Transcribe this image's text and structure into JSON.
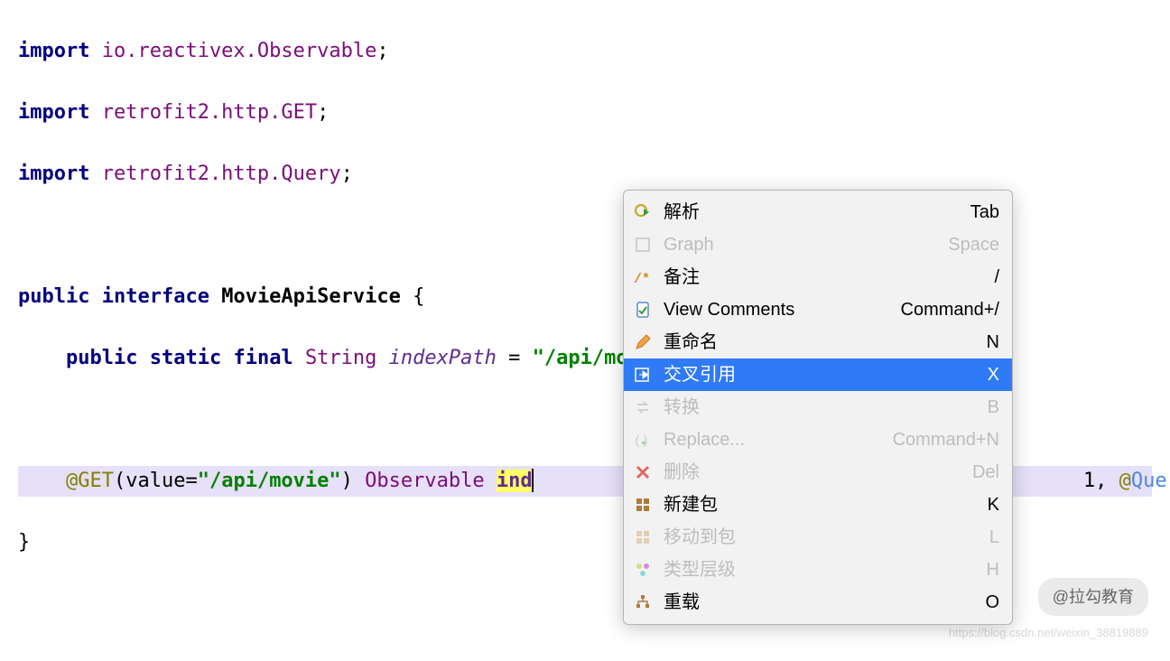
{
  "code": {
    "l1_kw_import": "import",
    "l1_pkg": "io.reactivex.Observable",
    "l2_kw_import": "import",
    "l2_pkg": "retrofit2.http.GET",
    "l3_kw_import": "import",
    "l3_pkg": "retrofit2.http.Query",
    "l5_kw_public": "public",
    "l5_kw_interface": "interface",
    "l5_class": "MovieApiService",
    "l5_brace": "{",
    "l6_kw_public": "public",
    "l6_kw_static": "static",
    "l6_kw_final": "final",
    "l6_type": "String",
    "l6_field": "indexPath",
    "l6_eq": " = ",
    "l6_str": "\"/api/movie\"",
    "l6_semi": ";",
    "l8_at": "@",
    "l8_ann": "GET",
    "l8_lp": "(",
    "l8_attr": "value",
    "l8_eq": "=",
    "l8_str": "\"/api/movie\"",
    "l8_rp": ") ",
    "l8_rettype": "Observable",
    "l8_sp": " ",
    "l8_sel": "ind",
    "l8_tail1": "1, ",
    "l8_at2": "@",
    "l8_ann2": "Query",
    "l9_brace": "}"
  },
  "menu": {
    "items": [
      {
        "id": "parse",
        "label": "解析",
        "shortcut": "Tab",
        "disabled": false,
        "icon": "gear-play"
      },
      {
        "id": "graph",
        "label": "Graph",
        "shortcut": "Space",
        "disabled": true,
        "icon": "box-outline"
      },
      {
        "id": "remark",
        "label": "备注",
        "shortcut": "/",
        "disabled": false,
        "icon": "comment-slash"
      },
      {
        "id": "view-comments",
        "label": "View Comments",
        "shortcut": "Command+/",
        "disabled": false,
        "icon": "clipboard-check"
      },
      {
        "id": "rename",
        "label": "重命名",
        "shortcut": "N",
        "disabled": false,
        "icon": "pencil"
      },
      {
        "id": "xref",
        "label": "交叉引用",
        "shortcut": "X",
        "disabled": false,
        "icon": "xref",
        "selected": true
      },
      {
        "id": "convert",
        "label": "转换",
        "shortcut": "B",
        "disabled": true,
        "icon": "swap"
      },
      {
        "id": "replace",
        "label": "Replace...",
        "shortcut": "Command+N",
        "disabled": true,
        "icon": "brackets"
      },
      {
        "id": "delete",
        "label": "删除",
        "shortcut": "Del",
        "disabled": true,
        "icon": "x-red"
      },
      {
        "id": "new-package",
        "label": "新建包",
        "shortcut": "K",
        "disabled": false,
        "icon": "grid"
      },
      {
        "id": "move-to-package",
        "label": "移动到包",
        "shortcut": "L",
        "disabled": true,
        "icon": "grid-faded"
      },
      {
        "id": "type-hierarchy",
        "label": "类型层级",
        "shortcut": "H",
        "disabled": true,
        "icon": "circles"
      },
      {
        "id": "override",
        "label": "重载",
        "shortcut": "O",
        "disabled": false,
        "icon": "tree"
      }
    ]
  },
  "watermark": {
    "badge": "@拉勾教育",
    "url": "https://blog.csdn.net/weixin_38819889"
  },
  "colors": {
    "menuSelected": "#2f7af7",
    "keyword": "#000080",
    "string": "#008000",
    "annotation": "#808000"
  }
}
